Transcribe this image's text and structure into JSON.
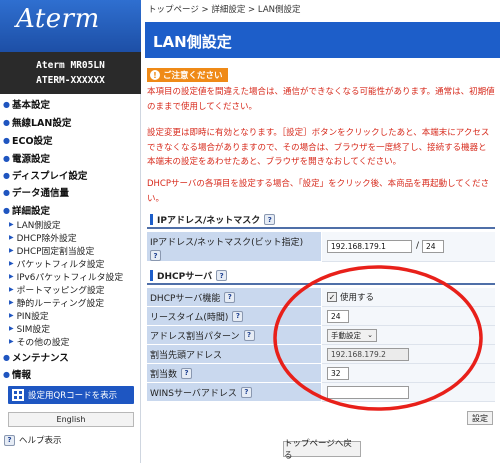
{
  "sidebar": {
    "logo": "Aterm",
    "model_line1": "Aterm   MR05LN",
    "model_line2": "ATERM-XXXXXX",
    "main_items": [
      {
        "label": "基本設定"
      },
      {
        "label": "無線LAN設定"
      },
      {
        "label": "ECO設定"
      },
      {
        "label": "電源設定"
      },
      {
        "label": "ディスプレイ設定"
      },
      {
        "label": "データ通信量"
      },
      {
        "label": "詳細設定"
      }
    ],
    "sub_items": [
      {
        "label": "LAN側設定"
      },
      {
        "label": "DHCP除外設定"
      },
      {
        "label": "DHCP固定割当設定"
      },
      {
        "label": "パケットフィルタ設定"
      },
      {
        "label": "IPv6パケットフィルタ設定"
      },
      {
        "label": "ポートマッピング設定"
      },
      {
        "label": "静的ルーティング設定"
      },
      {
        "label": "PIN設定"
      },
      {
        "label": "SIM設定"
      },
      {
        "label": "その他の設定"
      }
    ],
    "maint_items": [
      {
        "label": "メンテナンス"
      },
      {
        "label": "情報"
      }
    ],
    "qr_button": "設定用QRコードを表示",
    "english_button": "English",
    "help_link": "ヘルプ表示"
  },
  "breadcrumb": "トップページ > 詳細設定 > LAN側設定",
  "page_title": "LAN側設定",
  "notice_badge": "ご注意ください",
  "warnings": {
    "w1": "本項目の設定値を間違えた場合は、通信ができなくなる可能性があります。通常は、初期値のままで使用してください。",
    "w2": "設定変更は即時に有効となります。［設定］ボタンをクリックしたあと、本端末にアクセスできなくなる場合がありますので、その場合は、ブラウザを一度終了し、接続する機器と本端末の設定をあわせたあと、ブラウザを開きなおしてください。",
    "w3": "DHCPサーバの各項目を設定する場合、「設定」をクリック後、本商品を再起動してください。"
  },
  "ip_section": {
    "title": "IPアドレス/ネットマスク",
    "row_label": "IPアドレス/ネットマスク(ビット指定)",
    "ip_value": "192.168.179.1",
    "separator": "/",
    "mask_value": "24"
  },
  "dhcp_section": {
    "title": "DHCPサーバ",
    "rows": {
      "server": {
        "label": "DHCPサーバ機能",
        "checkbox_label": "使用する",
        "checked": true
      },
      "lease": {
        "label": "リースタイム(時間)",
        "value": "24"
      },
      "pattern": {
        "label": "アドレス割当パターン",
        "value": "手動設定"
      },
      "start": {
        "label": "割当先頭アドレス",
        "value": "192.168.179.2"
      },
      "count": {
        "label": "割当数",
        "value": "32"
      },
      "wins": {
        "label": "WINSサーバアドレス",
        "value": ""
      }
    }
  },
  "settings_button": "設定",
  "top_button": "トップページへ戻る",
  "help_icon_glyph": "?",
  "colors": {
    "accent": "#1d5ec9",
    "warning_text": "#d72a1c",
    "notice_badge": "#ef8a17",
    "highlight_ellipse": "#e8201a",
    "label_cell": "#c9d8ee"
  }
}
